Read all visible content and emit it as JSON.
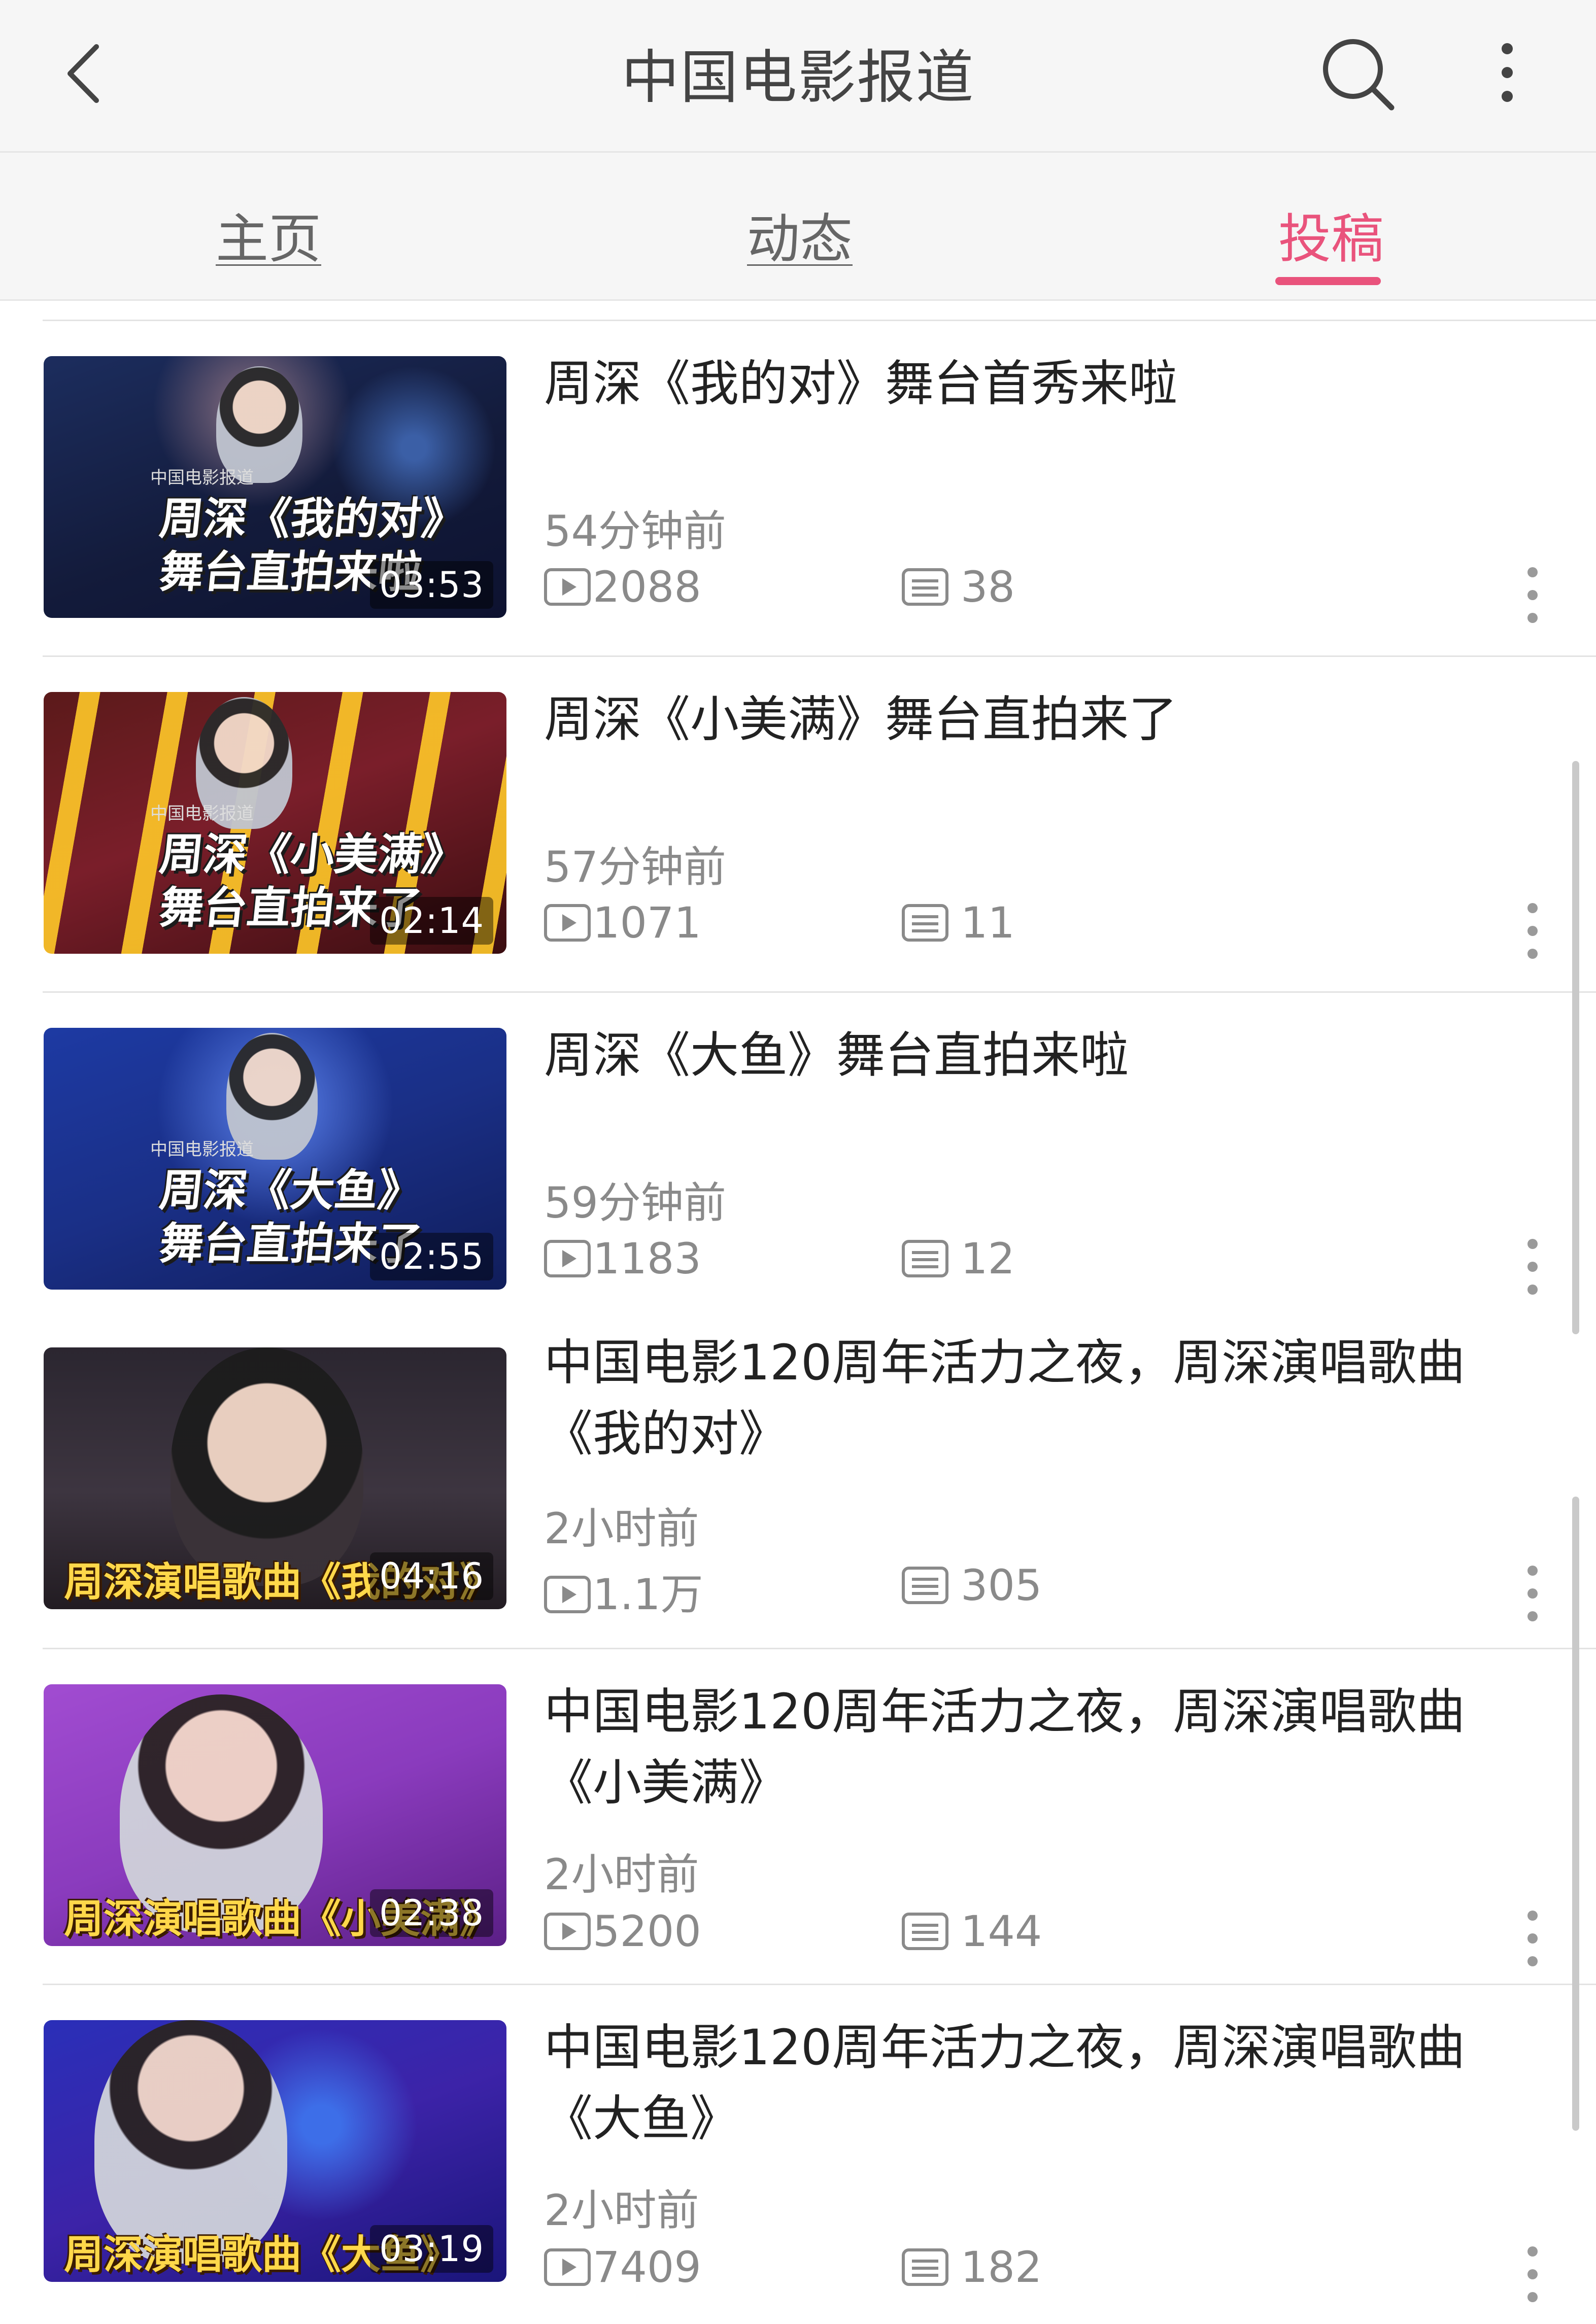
{
  "header": {
    "title": "中国电影报道",
    "back_icon": "chevron-left-icon",
    "search_icon": "search-icon",
    "more_icon": "more-vertical-icon"
  },
  "tabs": [
    {
      "label": "主页",
      "active": false
    },
    {
      "label": "动态",
      "active": false
    },
    {
      "label": "投稿",
      "active": true
    }
  ],
  "accent_color": "#e9537c",
  "videos": [
    {
      "title": "周深《我的对》舞台首秀来啦",
      "time": "54分钟前",
      "plays": "2088",
      "comments": "38",
      "duration": "03:53",
      "thumb_brand": "中国电影报道",
      "thumb_caption_1": "周深《我的对》",
      "thumb_caption_2": "舞台直拍来啦"
    },
    {
      "title": "周深《小美满》舞台直拍来了",
      "time": "57分钟前",
      "plays": "1071",
      "comments": "11",
      "duration": "02:14",
      "thumb_brand": "中国电影报道",
      "thumb_caption_1": "周深《小美满》",
      "thumb_caption_2": "舞台直拍来了"
    },
    {
      "title": "周深《大鱼》舞台直拍来啦",
      "time": "59分钟前",
      "plays": "1183",
      "comments": "12",
      "duration": "02:55",
      "thumb_brand": "中国电影报道",
      "thumb_caption_1": "周深《大鱼》",
      "thumb_caption_2": "舞台直拍来了"
    },
    {
      "title": "中国电影120周年活力之夜，周深演唱歌曲《我的对》",
      "time": "2小时前",
      "plays": "1.1万",
      "comments": "305",
      "duration": "04:16",
      "thumb_caption_wide": "周深演唱歌曲《我的对》"
    },
    {
      "title": "中国电影120周年活力之夜，周深演唱歌曲《小美满》",
      "time": "2小时前",
      "plays": "5200",
      "comments": "144",
      "duration": "02:38",
      "thumb_caption_wide": "周深演唱歌曲《小美满》"
    },
    {
      "title": "中国电影120周年活力之夜，周深演唱歌曲《大鱼》",
      "time": "2小时前",
      "plays": "7409",
      "comments": "182",
      "duration": "03:19",
      "thumb_caption_wide": "周深演唱歌曲《大鱼》"
    }
  ]
}
